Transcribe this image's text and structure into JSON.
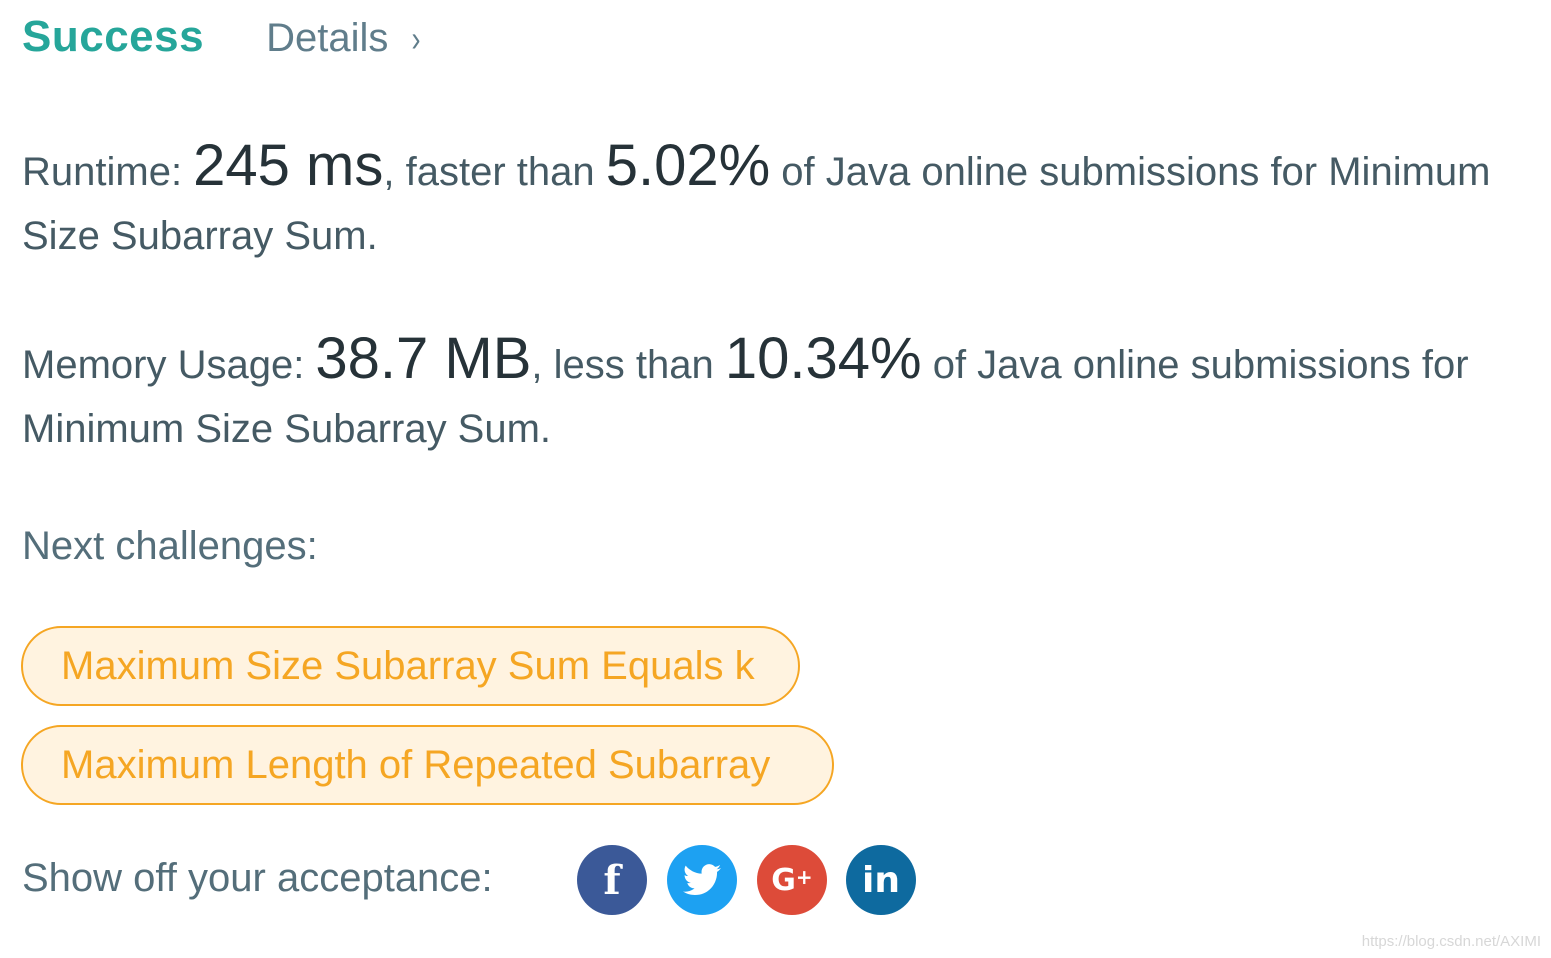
{
  "header": {
    "status": "Success",
    "details_label": "Details",
    "details_chevron": "›",
    "status_color": "#26a69a"
  },
  "runtime": {
    "label": "Runtime: ",
    "value": "245 ms",
    "comparison": ", faster than ",
    "percent": "5.02%",
    "suffix": " of Java online submissions for Minimum Size Subarray Sum."
  },
  "memory": {
    "label": "Memory Usage: ",
    "value": "38.7 MB",
    "comparison": ", less than ",
    "percent": "10.34%",
    "suffix": " of Java online submissions for Minimum Size Subarray Sum."
  },
  "next": {
    "label": "Next challenges:",
    "challenges": [
      "Maximum Size Subarray Sum Equals k",
      "Maximum Length of Repeated Subarray"
    ],
    "pill_color": "#f5a623"
  },
  "share": {
    "label": "Show off your acceptance:",
    "buttons": [
      {
        "icon": "facebook-icon",
        "glyph": "f",
        "color": "#3b5998"
      },
      {
        "icon": "twitter-icon",
        "glyph": "🐦",
        "color": "#1da1f2"
      },
      {
        "icon": "google-plus-icon",
        "glyph": "G+",
        "color": "#dd4b39"
      },
      {
        "icon": "linkedin-icon",
        "glyph": "in",
        "color": "#0e6a9f"
      }
    ]
  },
  "watermark": "https://blog.csdn.net/AXIMI"
}
